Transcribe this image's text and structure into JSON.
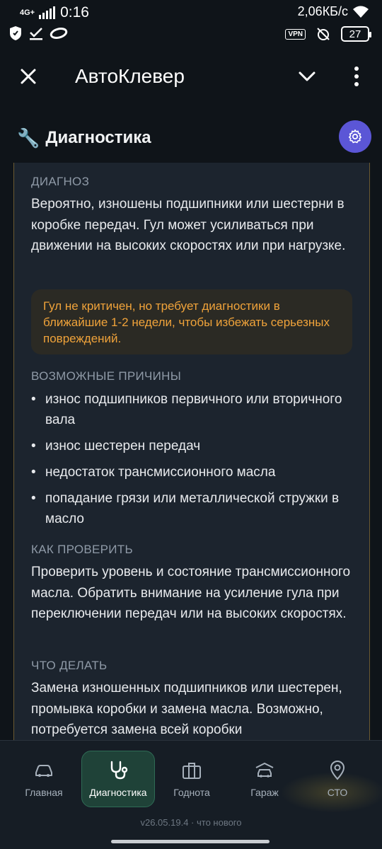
{
  "status_bar": {
    "network": "4G+",
    "time": "0:16",
    "speed": "2,06КБ/с",
    "vpn": "VPN",
    "battery": "27"
  },
  "app_bar": {
    "title": "АвтоКлевер",
    "close_icon": "close-icon",
    "chevron_icon": "chevron-down-icon",
    "more_icon": "more-vert-icon"
  },
  "section": {
    "icon": "🔧",
    "title": "Диагностика",
    "settings_icon": "gear-icon"
  },
  "diagnosis": {
    "label": "ДИАГНОЗ",
    "text": "Вероятно, изношены подшипники или шестерни в коробке передач. Гул может усиливаться при движении на высоких скоростях или при нагрузке.",
    "warning": "Гул не критичен, но требует диагностики в ближайшие 1-2 недели, чтобы избежать серьезных повреждений."
  },
  "causes": {
    "label": "ВОЗМОЖНЫЕ ПРИЧИНЫ",
    "items": [
      "износ подшипников первичного или вторичного вала",
      "износ шестерен передач",
      "недостаток трансмиссионного масла",
      "попадание грязи или металлической стружки в масло"
    ]
  },
  "check": {
    "label": "КАК ПРОВЕРИТЬ",
    "text": "Проверить уровень и состояние трансмиссионного масла. Обратить внимание на усиление гула при переключении передач или на высоких скоростях."
  },
  "todo": {
    "label": "ЧТО ДЕЛАТЬ",
    "text": "Замена изношенных подшипников или шестерен, промывка коробки и замена масла. Возможно, потребуется замена всей коробки"
  },
  "bottom_nav": {
    "items": [
      {
        "label": "Главная",
        "icon": "car-icon"
      },
      {
        "label": "Диагностика",
        "icon": "stethoscope-icon"
      },
      {
        "label": "Годнота",
        "icon": "briefcase-icon"
      },
      {
        "label": "Гараж",
        "icon": "garage-car-icon"
      },
      {
        "label": "СТО",
        "icon": "location-pin-icon"
      }
    ],
    "active": "Диагностика",
    "version": "v26.05.19.4 · что нового"
  },
  "colors": {
    "background": "#0f1419",
    "card": "#1c242e",
    "accent": "#5b56d6",
    "warning_text": "#f0a33a",
    "active_nav": "#1f4238"
  }
}
